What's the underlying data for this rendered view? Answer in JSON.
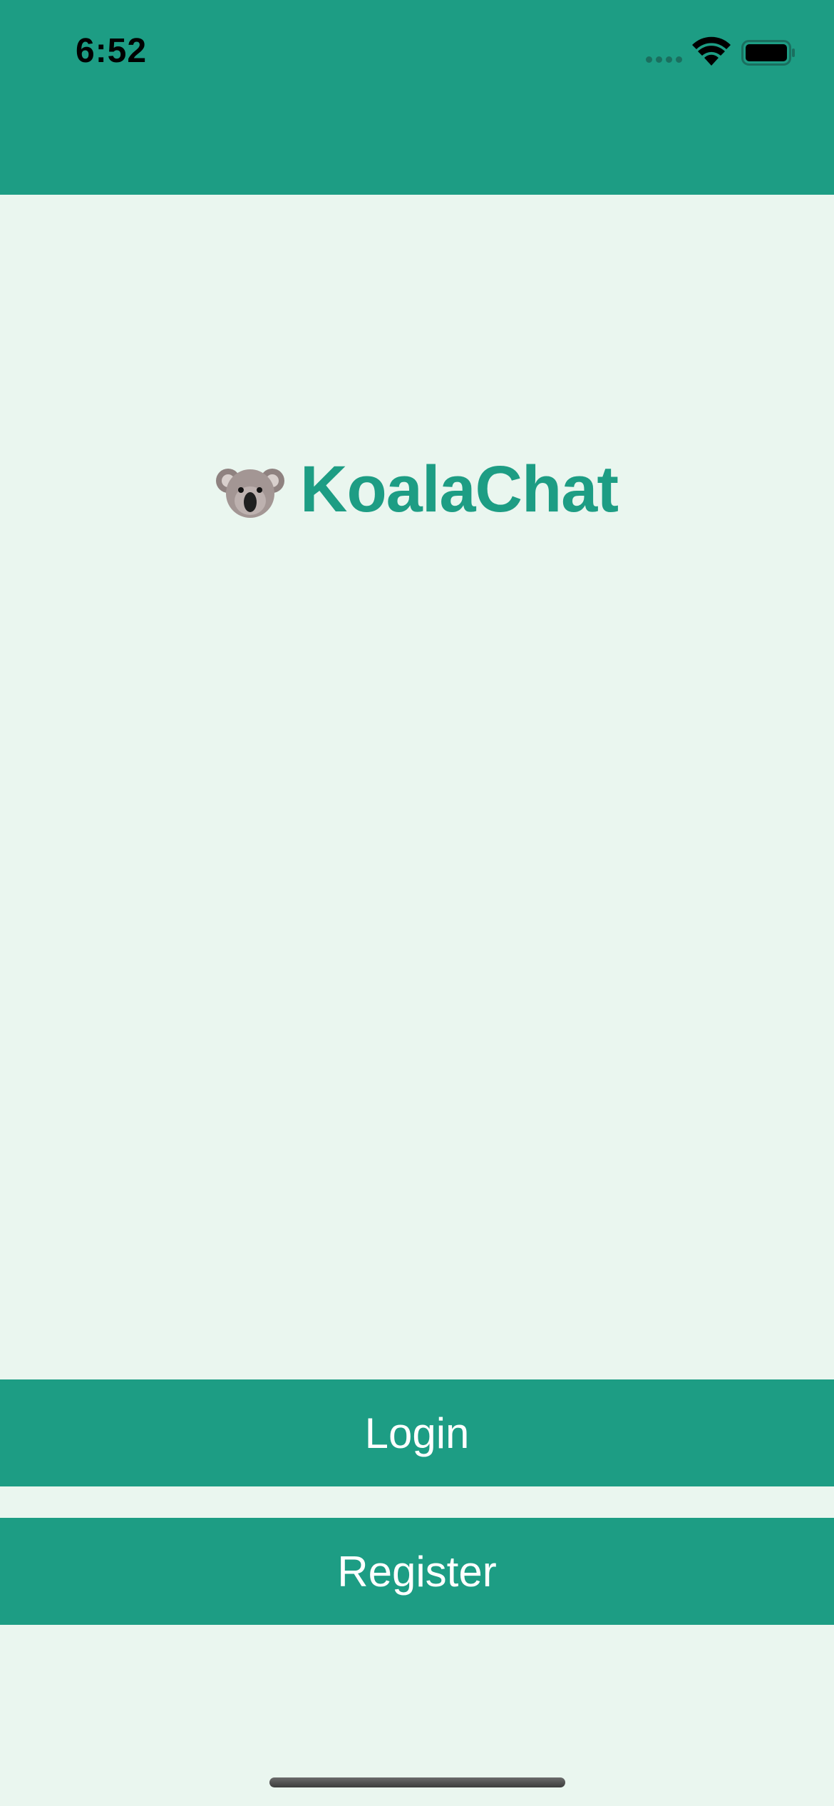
{
  "status_bar": {
    "time": "6:52",
    "icons": [
      "cellular-signal-icon",
      "wifi-icon",
      "battery-icon"
    ]
  },
  "brand": {
    "logo_icon": "koala-face-icon",
    "name": "KoalaChat"
  },
  "actions": {
    "login_label": "Login",
    "register_label": "Register"
  },
  "colors": {
    "accent": "#1d9d84",
    "background": "#eaf6ef",
    "button_text": "#ffffff"
  }
}
